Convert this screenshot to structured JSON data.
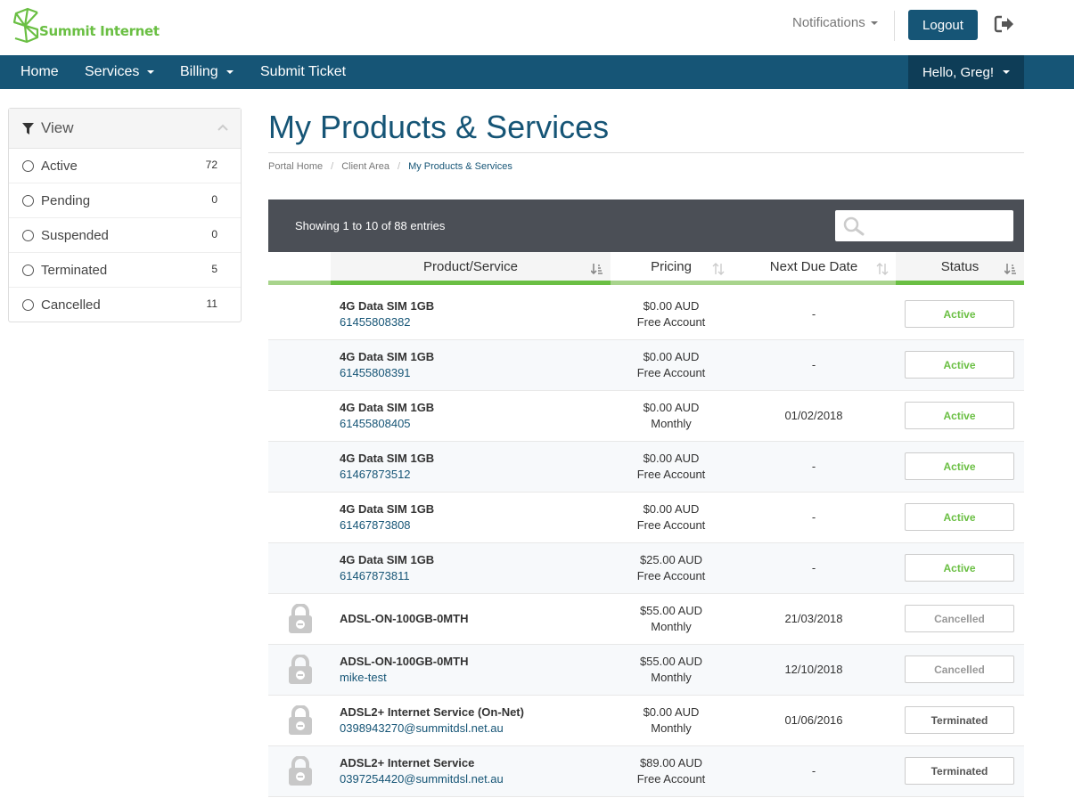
{
  "brand": {
    "name": "Summit Internet",
    "color": "#6abf43",
    "primary": "#165576"
  },
  "header": {
    "notifications_label": "Notifications",
    "logout_label": "Logout"
  },
  "nav": {
    "items": [
      {
        "label": "Home",
        "has_dropdown": false
      },
      {
        "label": "Services",
        "has_dropdown": true
      },
      {
        "label": "Billing",
        "has_dropdown": true
      },
      {
        "label": "Submit Ticket",
        "has_dropdown": false
      }
    ],
    "user_label": "Hello, Greg!"
  },
  "sidebar": {
    "title": "View",
    "items": [
      {
        "label": "Active",
        "count": "72"
      },
      {
        "label": "Pending",
        "count": "0"
      },
      {
        "label": "Suspended",
        "count": "0"
      },
      {
        "label": "Terminated",
        "count": "5"
      },
      {
        "label": "Cancelled",
        "count": "11"
      }
    ]
  },
  "main": {
    "title": "My Products & Services",
    "breadcrumb": [
      "Portal Home",
      "Client Area",
      "My Products & Services"
    ],
    "showing": "Showing 1 to 10 of 88 entries",
    "search_placeholder": "",
    "columns": [
      "Product/Service",
      "Pricing",
      "Next Due Date",
      "Status"
    ],
    "rows": [
      {
        "name": "4G Data SIM 1GB",
        "sub": "61455808382",
        "price": "$0.00 AUD",
        "cycle": "Free Account",
        "due": "-",
        "status": "Active",
        "locked": false
      },
      {
        "name": "4G Data SIM 1GB",
        "sub": "61455808391",
        "price": "$0.00 AUD",
        "cycle": "Free Account",
        "due": "-",
        "status": "Active",
        "locked": false
      },
      {
        "name": "4G Data SIM 1GB",
        "sub": "61455808405",
        "price": "$0.00 AUD",
        "cycle": "Monthly",
        "due": "01/02/2018",
        "status": "Active",
        "locked": false
      },
      {
        "name": "4G Data SIM 1GB",
        "sub": "61467873512",
        "price": "$0.00 AUD",
        "cycle": "Free Account",
        "due": "-",
        "status": "Active",
        "locked": false
      },
      {
        "name": "4G Data SIM 1GB",
        "sub": "61467873808",
        "price": "$0.00 AUD",
        "cycle": "Free Account",
        "due": "-",
        "status": "Active",
        "locked": false
      },
      {
        "name": "4G Data SIM 1GB",
        "sub": "61467873811",
        "price": "$25.00 AUD",
        "cycle": "Free Account",
        "due": "-",
        "status": "Active",
        "locked": false
      },
      {
        "name": "ADSL-ON-100GB-0MTH",
        "sub": "",
        "price": "$55.00 AUD",
        "cycle": "Monthly",
        "due": "21/03/2018",
        "status": "Cancelled",
        "locked": true
      },
      {
        "name": "ADSL-ON-100GB-0MTH",
        "sub": "mike-test",
        "price": "$55.00 AUD",
        "cycle": "Monthly",
        "due": "12/10/2018",
        "status": "Cancelled",
        "locked": true
      },
      {
        "name": "ADSL2+ Internet Service (On-Net)",
        "sub": "0398943270@summitdsl.net.au",
        "price": "$0.00 AUD",
        "cycle": "Monthly",
        "due": "01/06/2016",
        "status": "Terminated",
        "locked": true
      },
      {
        "name": "ADSL2+ Internet Service",
        "sub": "0397254420@summitdsl.net.au",
        "price": "$89.00 AUD",
        "cycle": "Free Account",
        "due": "-",
        "status": "Terminated",
        "locked": true
      }
    ]
  },
  "status_colors": {
    "Active": "#6abf43",
    "Cancelled": "#999999",
    "Terminated": "#555555"
  }
}
